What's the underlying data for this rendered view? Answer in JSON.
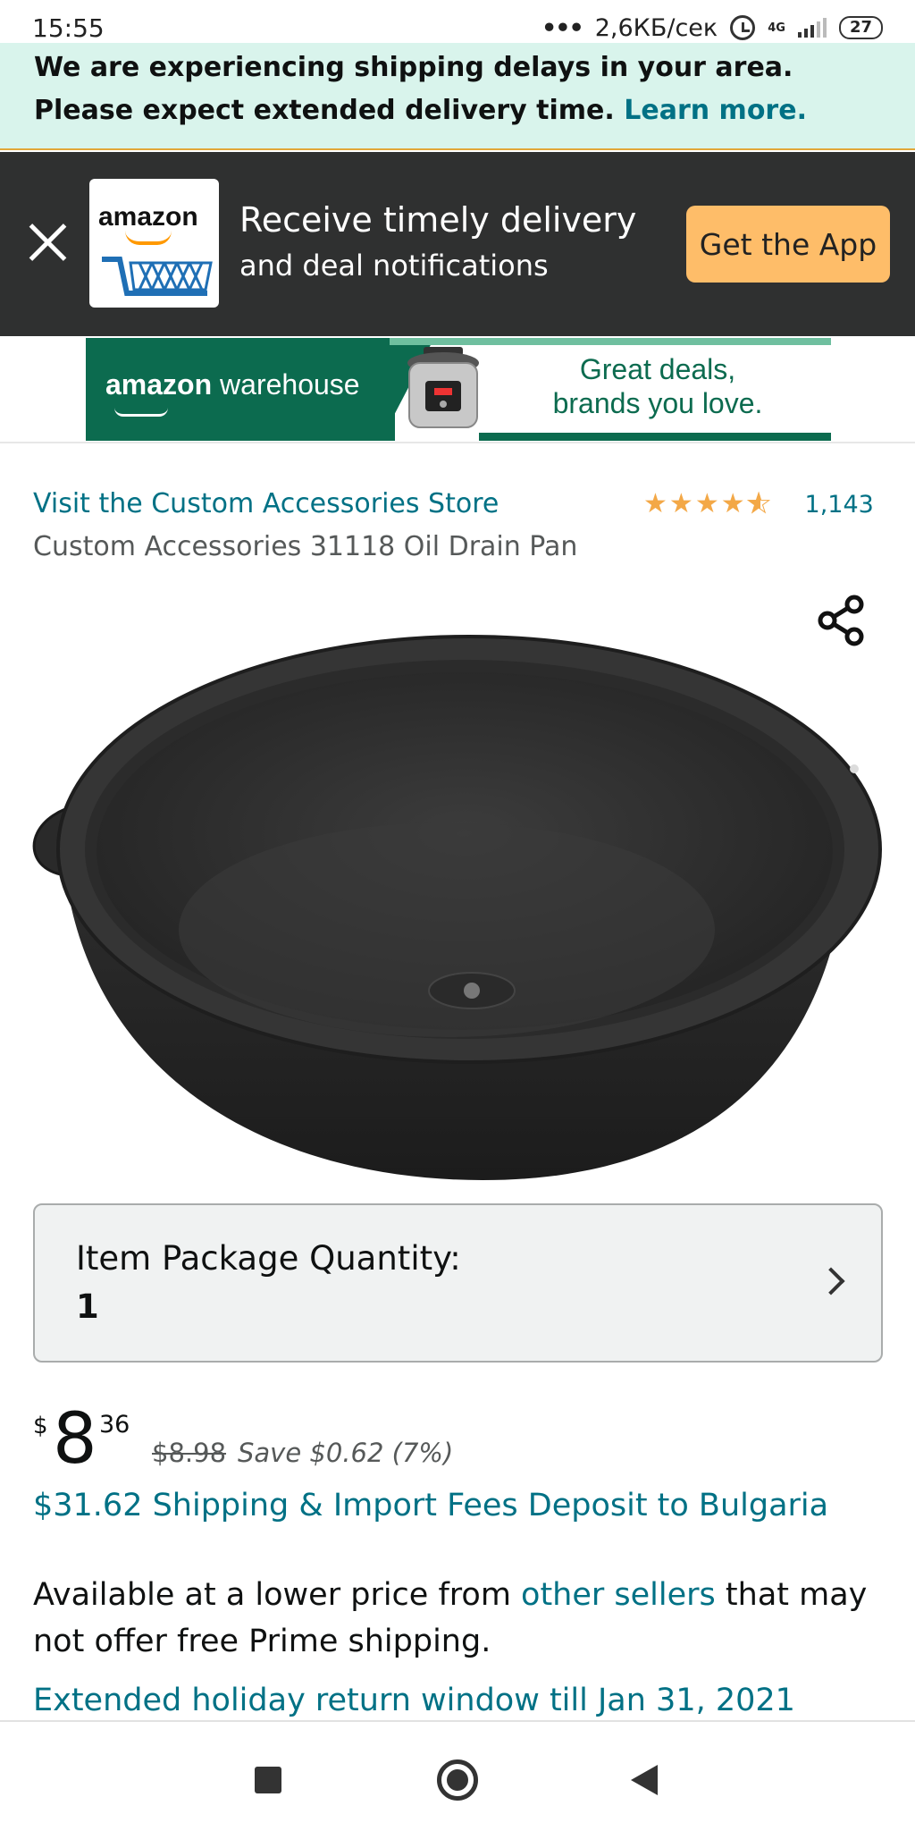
{
  "status_bar": {
    "time": "15:55",
    "network_speed": "2,6КБ/сек",
    "network_type": "4G",
    "battery": "27"
  },
  "notice": {
    "text": "We are experiencing shipping delays in your area. Please expect extended delivery time.",
    "link": "Learn more."
  },
  "app_banner": {
    "logo_text": "amazon",
    "title": "Receive timely delivery",
    "subtitle": "and deal notifications",
    "button": "Get the App"
  },
  "ad": {
    "brand_strong": "amazon",
    "brand_rest": " warehouse",
    "tagline_line1": "Great deals,",
    "tagline_line2": "brands you love."
  },
  "product": {
    "store_link": "Visit the Custom Accessories Store",
    "rating_value": 4.5,
    "rating_count": "1,143",
    "title": "Custom Accessories 31118 Oil Drain Pan"
  },
  "quantity": {
    "label": "Item Package Quantity:",
    "value": "1"
  },
  "price": {
    "currency": "$",
    "whole": "8",
    "fraction": "36",
    "list_price": "$8.98",
    "savings": "Save $0.62 (7%)",
    "shipping_fees": "$31.62 Shipping & Import Fees Deposit to Bulgaria",
    "avail_before": "Available at a lower price from ",
    "avail_link": "other sellers",
    "avail_after": " that may not offer free Prime shipping.",
    "return_link": "Extended holiday return window till Jan 31, 2021"
  },
  "colors": {
    "link": "#007185",
    "star": "#f3a847",
    "app_button": "#febd69",
    "banner_bg": "#2f3030",
    "notice_bg": "#d9f4ec",
    "warehouse_green": "#0c6b4f"
  },
  "icons": {
    "close": "close-icon",
    "share": "share-icon",
    "chevron": "chevron-right-icon",
    "nav_recents": "recents-icon",
    "nav_home": "home-icon",
    "nav_back": "back-icon"
  }
}
